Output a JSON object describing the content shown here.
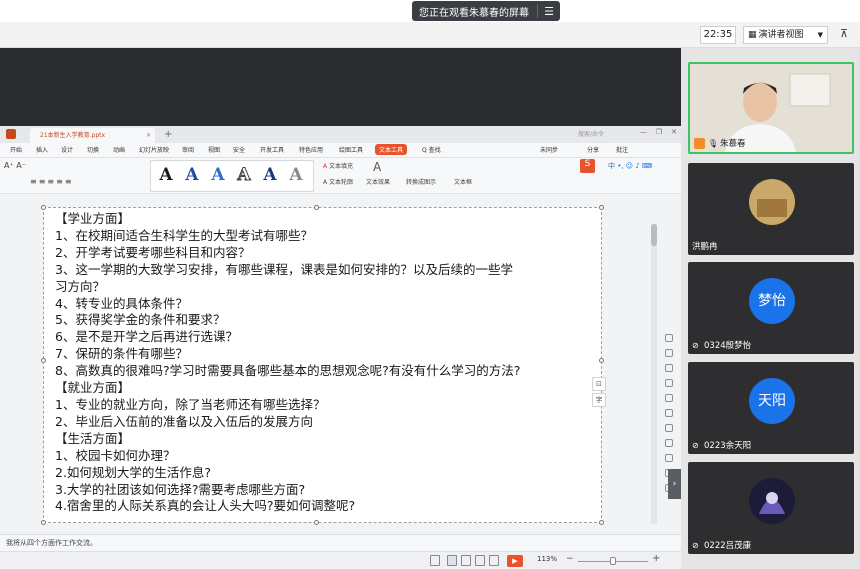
{
  "banner": {
    "text": "您正在观看朱慕春的屏幕",
    "menu_icon": "menu-icon"
  },
  "meeting_bar": {
    "time": "22:35",
    "presenter_view": "演讲者视图",
    "pin_icon": "pin-icon"
  },
  "wps": {
    "doc_tab": "21本新生入学教育.pptx",
    "search_placeholder": "搜索/命令",
    "menu": [
      "开始",
      "插入",
      "设计",
      "切换",
      "动画",
      "幻灯片放映",
      "审阅",
      "视图",
      "安全",
      "开发工具",
      "特色应用",
      "绘图工具",
      "文本工具",
      "Q 查找"
    ],
    "menu_right": [
      "未同步",
      "分享",
      "批注"
    ],
    "ribbon": {
      "text_fill": "文本填充",
      "text_outline": "文本轮廓",
      "text_effects": "文本效果",
      "wrap": "转换成图示",
      "text_box": "文本框",
      "art_letters": [
        "A",
        "A",
        "A",
        "A",
        "A",
        "A"
      ]
    },
    "slide_lines": [
      "【学业方面】",
      "1、在校期间适合生科学生的大型考试有哪些？",
      "2、开学考试要考哪些科目和内容？",
      "3、这一学期的大致学习安排，有哪些课程，课表是如何安排的？以及后续的一些学",
      "习方向？",
      "4、转专业的具体条件？",
      "5、获得奖学金的条件和要求？",
      "6、是不是开学之后再进行选课？",
      "7、保研的条件有哪些？",
      "8、高数真的很难吗?学习时需要具备哪些基本的思想观念呢?有没有什么学习的方法?",
      "【就业方面】",
      "1、专业的就业方向，除了当老师还有哪些选择？",
      "2、毕业后入伍前的准备以及入伍后的发展方向",
      "【生活方面】",
      "1、校园卡如何办理？",
      "2.如何规划大学的生活作息?",
      "3.大学的社团该如何选择?需要考虑哪些方面?",
      "4.宿舍里的人际关系真的会让人头大吗?要如何调整呢?"
    ],
    "notes": "我将从四个方面作工作交流。",
    "zoom": "113%"
  },
  "participants": [
    {
      "name": "朱慕春",
      "host": true,
      "mic_on": true
    },
    {
      "name": "洪鹏冉",
      "mic_on": false
    },
    {
      "name": "0324殷梦怡",
      "avatar": "梦怡",
      "mic_on": false
    },
    {
      "name": "0223余天阳",
      "avatar": "天阳",
      "mic_on": false
    },
    {
      "name": "0222吕茂康",
      "mic_on": false
    }
  ],
  "colors": {
    "accent": "#e9532b",
    "avatar_blue": "#1a73e8",
    "active_speaker": "#3cc463"
  }
}
